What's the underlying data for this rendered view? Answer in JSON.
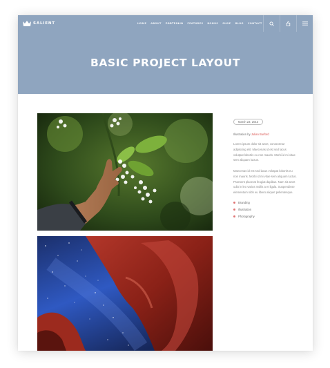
{
  "header": {
    "logo_text": "SALIENT",
    "nav": [
      "HOME",
      "ABOUT",
      "PORTFOLIO",
      "FEATURES",
      "BONUS",
      "SHOP",
      "BLOG",
      "CONTACT"
    ],
    "active_nav": "PORTFOLIO",
    "icons": [
      "search-icon",
      "cart-icon",
      "menu-icon"
    ],
    "color": "#8fa5bf"
  },
  "hero": {
    "title": "BASIC PROJECT LAYOUT"
  },
  "sidebar": {
    "date": "March 23, 2013",
    "byline_prefix": "Illustration by",
    "author": "Julian Burford",
    "paragraphs": [
      "Lorem ipsum dolor sit amet, consectetur adipiscing elit. Maecenas id est sed lacus volutpat lobortis eu non mauris. Morbi id mi vitae sem aliquam luctus.",
      "Maecenas id est sed lacus volutpat lobortis eu non mauris. Morbi id mi vitae sem aliquam luctus. Praesent placerat feugiat dapibus. Nam sit amet odio in leo varius mollis a et ligula. Suspendisse elementum nibh eu libero aliquet pellentesque."
    ],
    "tags": [
      "Branding",
      "Illustration",
      "Photography"
    ],
    "accent": "#d9534f"
  },
  "gallery": {
    "images": [
      "hand reaching toward white flowers",
      "starry night sky through red canyon"
    ]
  }
}
